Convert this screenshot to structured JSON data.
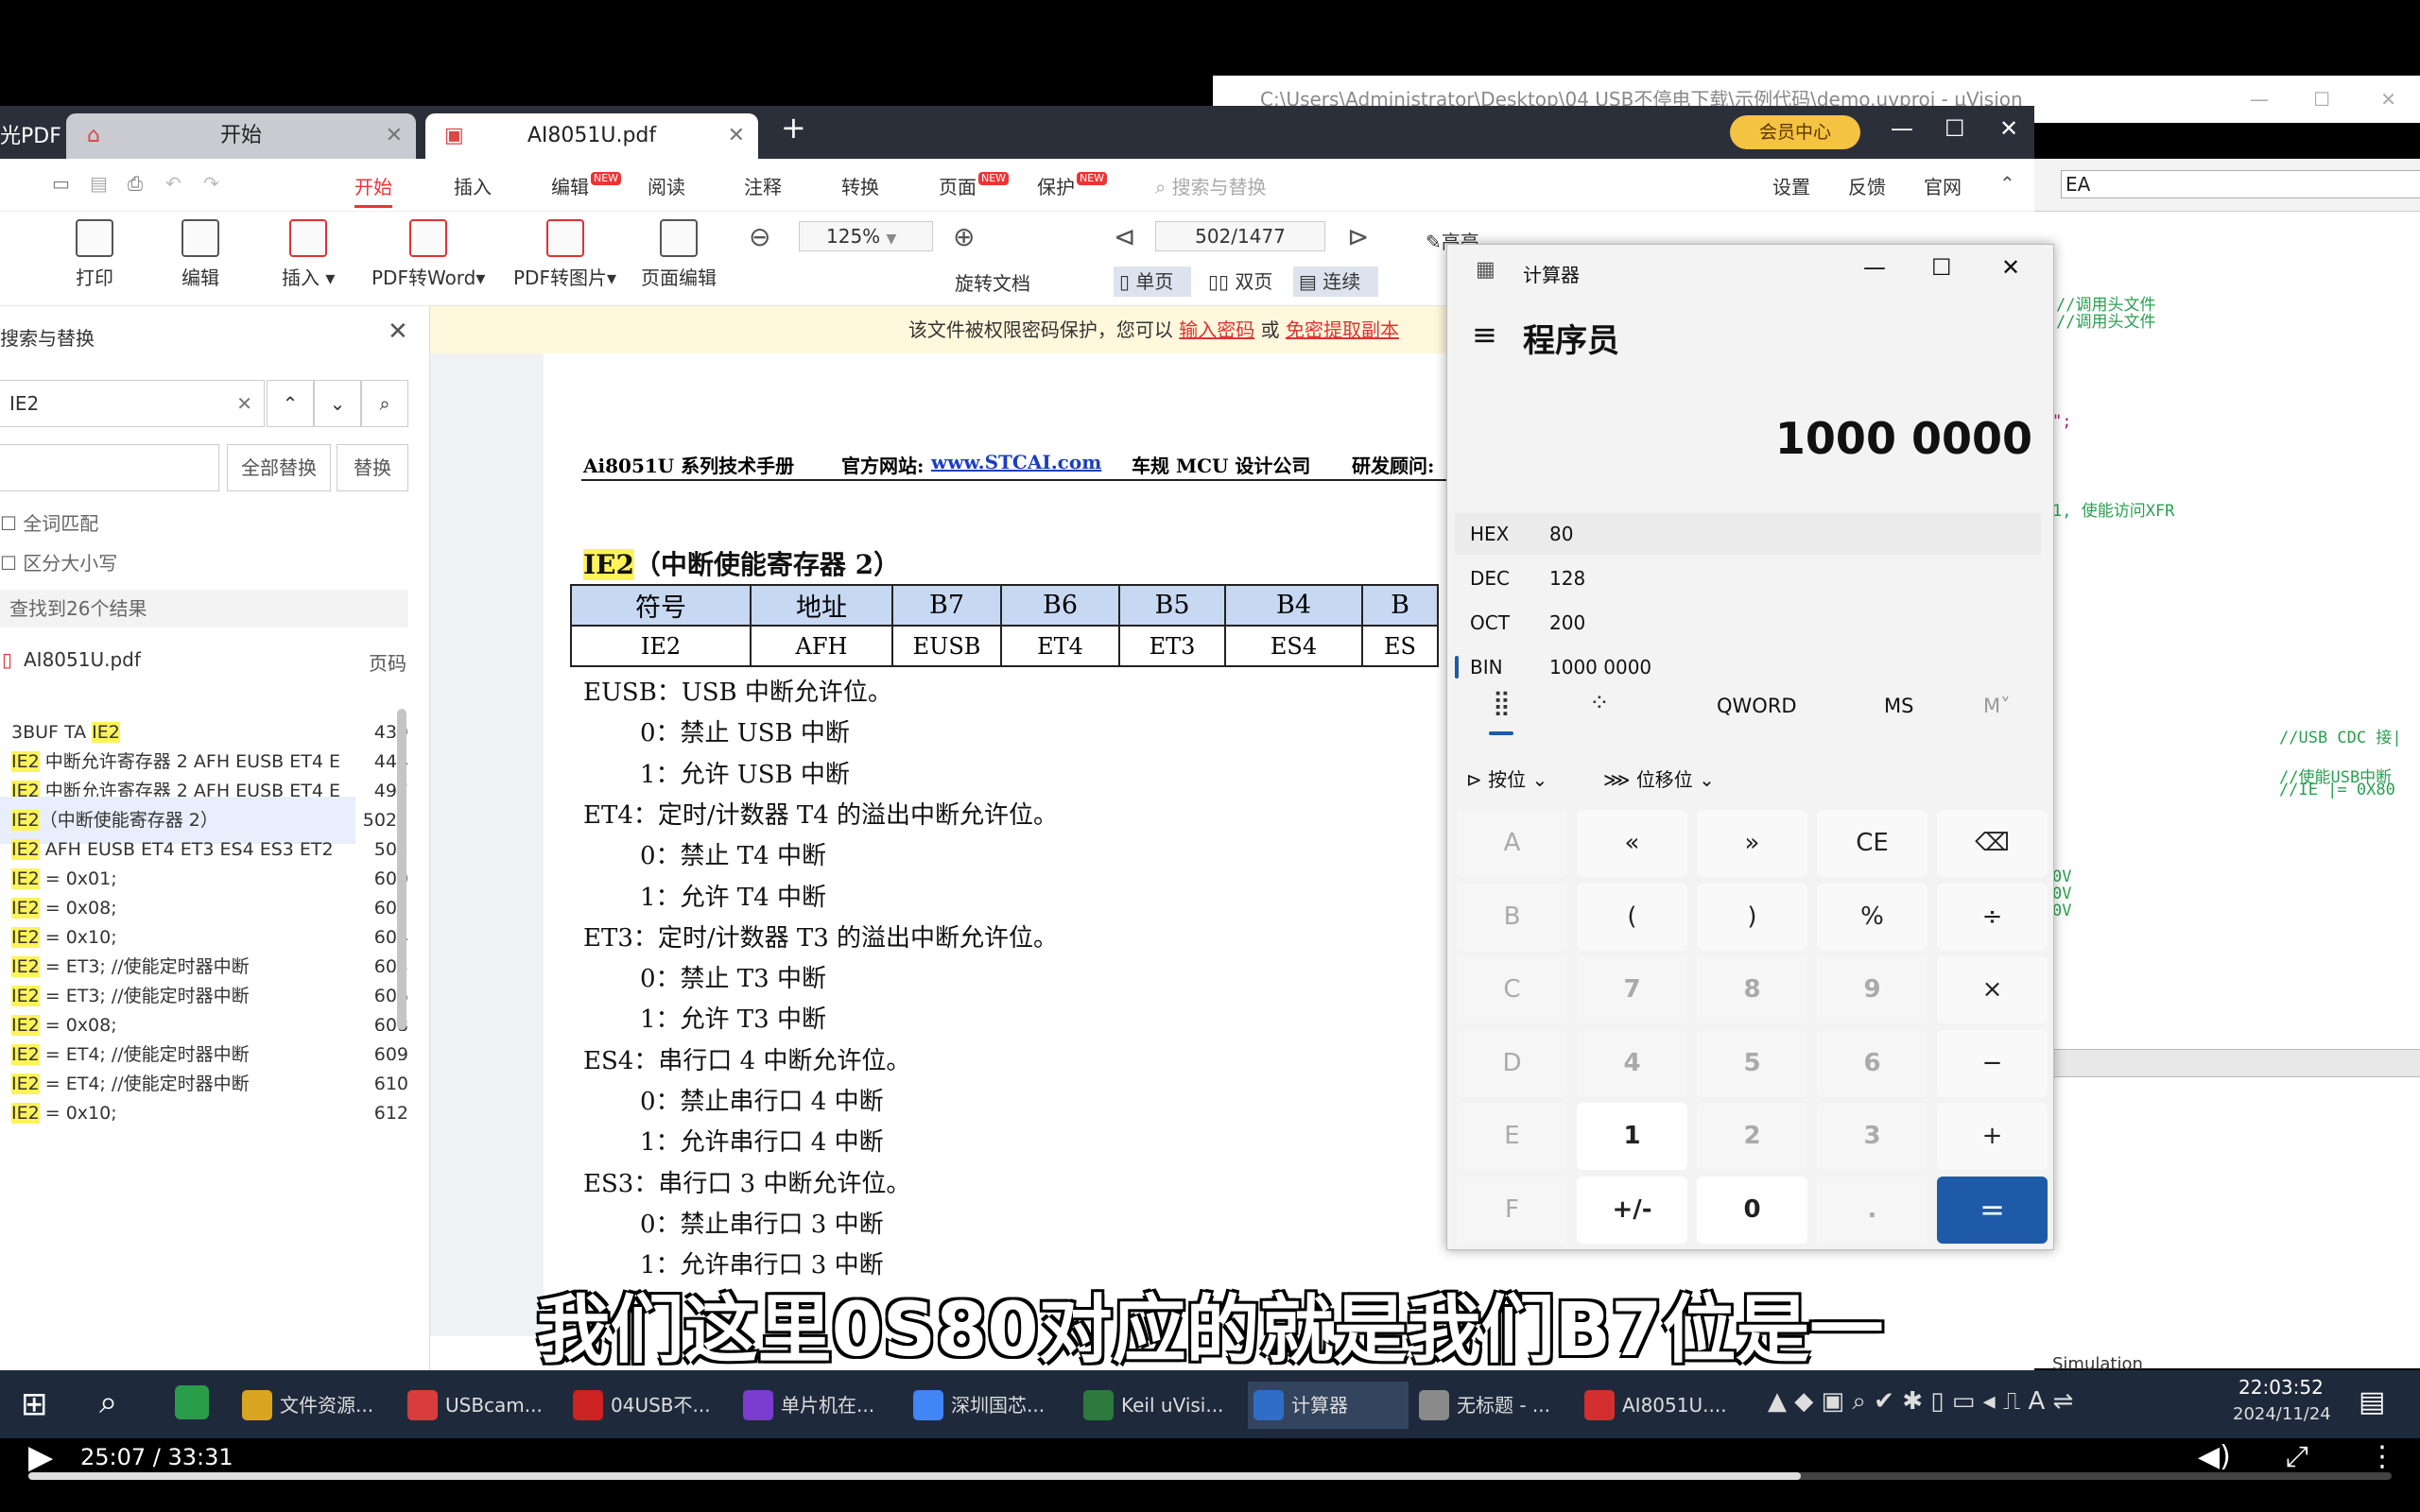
{
  "uvision": {
    "title": "C:\\Users\\Administrator\\Desktop\\04 USB不停电下载\\示例代码\\demo.uvproj - µVision",
    "combo_value": "EA",
    "code_lines": [
      "//调用头文件",
      "//调用头文件",
      "\";",
      "1, 使能访问XFR",
      "//USB CDC 接|",
      "//使能USB中断",
      "//IE |= 0X80",
      "0V",
      "0V",
      "0V"
    ],
    "status": "Simulation"
  },
  "pdf": {
    "app_name": "光PDF",
    "tabs": [
      {
        "label": "开始"
      },
      {
        "label": "AI8051U.pdf"
      }
    ],
    "vip_label": "会员中心",
    "menu": {
      "start": "开始",
      "insert": "插入",
      "edit": "编辑",
      "read": "阅读",
      "annotate": "注释",
      "convert": "转换",
      "page": "页面",
      "protect": "保护",
      "search_placeholder": "搜索与替换",
      "settings": "设置",
      "feedback": "反馈",
      "website": "官网"
    },
    "new_badge": "NEW",
    "ribbon": {
      "print": "打印",
      "edit": "编辑",
      "insert": "插入",
      "to_word": "PDF转Word",
      "to_image": "PDF转图片",
      "page_edit": "页面编辑",
      "zoom": "125%",
      "page_number": "502/1477",
      "rotate": "旋转文档",
      "single": "单页",
      "double": "双页",
      "continuous": "连续",
      "highlight": "高亮"
    },
    "notice": {
      "text": "该文件被权限密码保护，您可以",
      "link1": "输入密码",
      "or": "或",
      "link2": "免密提取副本"
    }
  },
  "search_panel": {
    "title": "搜索与替换",
    "query": "IE2",
    "replace_all": "全部替换",
    "replace": "替换",
    "match_whole": "全词匹配",
    "match_case": "区分大小写",
    "result_count": "查找到26个结果",
    "file_name": "AI8051U.pdf",
    "page_header": "页码",
    "results": [
      {
        "pre": "3BUF TA ",
        "hit": "IE2",
        "post": "",
        "page": "439"
      },
      {
        "pre": "",
        "hit": "IE2",
        "post": " 中断允许寄存器 2 AFH EUSB ET4 E",
        "page": "444"
      },
      {
        "pre": "",
        "hit": "IE2",
        "post": " 中断允许寄存器 2 AFH EUSB ET4 E",
        "page": "497"
      },
      {
        "pre": "",
        "hit": "IE2",
        "post": "（中断使能寄存器 2）",
        "page": "502"
      },
      {
        "pre": "",
        "hit": "IE2",
        "post": " AFH EUSB ET4 ET3 ES4 ES3 ET2",
        "page": "502"
      },
      {
        "pre": "",
        "hit": "IE2",
        "post": " = 0x01;",
        "page": "600"
      },
      {
        "pre": "",
        "hit": "IE2",
        "post": " = 0x08;",
        "page": "602"
      },
      {
        "pre": "",
        "hit": "IE2",
        "post": " = 0x10;",
        "page": "604"
      },
      {
        "pre": "",
        "hit": "IE2",
        "post": " = ET3; //使能定时器中断",
        "page": "605"
      },
      {
        "pre": "",
        "hit": "IE2",
        "post": " = ET3; //使能定时器中断",
        "page": "606"
      },
      {
        "pre": "",
        "hit": "IE2",
        "post": " = 0x08;",
        "page": "608"
      },
      {
        "pre": "",
        "hit": "IE2",
        "post": " = ET4; //使能定时器中断",
        "page": "609"
      },
      {
        "pre": "",
        "hit": "IE2",
        "post": " = ET4; //使能定时器中断",
        "page": "610"
      },
      {
        "pre": "",
        "hit": "IE2",
        "post": " = 0x10;",
        "page": "612"
      }
    ]
  },
  "document": {
    "header": {
      "title": "Ai8051U 系列技术手册",
      "site_label": "官方网站:",
      "site_url": "www.STCAI.com",
      "company": "车规 MCU 设计公司",
      "advisor": "研发顾问:"
    },
    "section_hit": "IE2",
    "section_title": "（中断使能寄存器 2）",
    "table": {
      "headers": [
        "符号",
        "地址",
        "B7",
        "B6",
        "B5",
        "B4",
        "B"
      ],
      "row": [
        "IE2",
        "AFH",
        "EUSB",
        "ET4",
        "ET3",
        "ES4",
        "ES"
      ]
    },
    "lines": [
      {
        "indent": false,
        "text": "EUSB：USB 中断允许位。"
      },
      {
        "indent": true,
        "text": "0：禁止 USB 中断"
      },
      {
        "indent": true,
        "text": "1：允许 USB 中断"
      },
      {
        "indent": false,
        "text": "ET4：定时/计数器 T4 的溢出中断允许位。"
      },
      {
        "indent": true,
        "text": "0：禁止 T4 中断"
      },
      {
        "indent": true,
        "text": "1：允许 T4 中断"
      },
      {
        "indent": false,
        "text": "ET3：定时/计数器 T3 的溢出中断允许位。"
      },
      {
        "indent": true,
        "text": "0：禁止 T3 中断"
      },
      {
        "indent": true,
        "text": "1：允许 T3 中断"
      },
      {
        "indent": false,
        "text": "ES4：串行口 4 中断允许位。"
      },
      {
        "indent": true,
        "text": "0：禁止串行口 4 中断"
      },
      {
        "indent": true,
        "text": "1：允许串行口 4 中断"
      },
      {
        "indent": false,
        "text": "ES3：串行口 3 中断允许位。"
      },
      {
        "indent": true,
        "text": "0：禁止串行口 3 中断"
      },
      {
        "indent": true,
        "text": "1：允许串行口 3 中断"
      }
    ]
  },
  "calculator": {
    "title": "计算器",
    "mode": "程序员",
    "display": "1000 0000",
    "radix": [
      {
        "label": "HEX",
        "value": "80"
      },
      {
        "label": "DEC",
        "value": "128"
      },
      {
        "label": "OCT",
        "value": "200"
      },
      {
        "label": "BIN",
        "value": "1000 0000"
      }
    ],
    "word_size": "QWORD",
    "ms": "MS",
    "mv": "M˅",
    "bitwise": "按位",
    "bitshift": "位移位",
    "keys": [
      "A",
      "«",
      "»",
      "CE",
      "⌫",
      "B",
      "(",
      ")",
      "%",
      "÷",
      "C",
      "7",
      "8",
      "9",
      "×",
      "D",
      "4",
      "5",
      "6",
      "−",
      "E",
      "1",
      "2",
      "3",
      "+",
      "F",
      "+/-",
      "0",
      ".",
      "="
    ]
  },
  "subtitle": "我们这里0S80对应的就是我们B7位是一",
  "taskbar": {
    "items": [
      "文件资源...",
      "USBcam...",
      "04USB不...",
      "单片机在...",
      "深圳国芯...",
      "Keil uVisi...",
      "计算器",
      "无标题 - ...",
      "AI8051U...."
    ],
    "time": "22:03:52",
    "date": "2024/11/24"
  },
  "player": {
    "time": "25:07 / 33:31",
    "progress": 0.75
  }
}
